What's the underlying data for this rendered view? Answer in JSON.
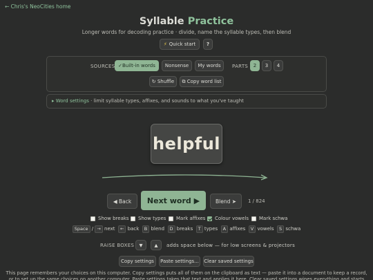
{
  "home_link": "← Chris's NeoCities home",
  "title": {
    "main": "Syllable",
    "accent": "Practice"
  },
  "subtitle": "Longer words for decoding practice · divide, name the syllable types, then blend",
  "quick_start": {
    "icon": "⚡",
    "label": "Quick start",
    "help": "?"
  },
  "sources": {
    "label": "SOURCES",
    "builtin": "✓Built-in words",
    "nonsense": "Nonsense",
    "my_words": "My words"
  },
  "parts": {
    "label": "PARTS",
    "options": [
      "2",
      "3",
      "4"
    ],
    "selected": "2"
  },
  "shuffle": "↻ Shuffle",
  "copy_list": "⧉ Copy word list",
  "word_settings": {
    "heading": "▸ Word settings",
    "text": " · limit syllable types, affixes, and sounds to what you've taught"
  },
  "current_word": "helpful",
  "nav": {
    "back": "◀ Back",
    "next": "Next word ▶",
    "blend": "Blend ➤",
    "counter": "1 / 824"
  },
  "toggles": [
    {
      "label": "Show breaks",
      "checked": false
    },
    {
      "label": "Show types",
      "checked": false
    },
    {
      "label": "Mark affixes",
      "checked": false
    },
    {
      "label": "Colour vowels",
      "checked": true
    },
    {
      "label": "Mark schwa",
      "checked": false
    }
  ],
  "shortcuts": {
    "space": "Space",
    "slash": "/",
    "arrow_right": "→",
    "next": "next",
    "arrow_left": "←",
    "back": "back",
    "b": "B",
    "blend": "blend",
    "d": "D",
    "breaks": "breaks",
    "t": "T",
    "types": "types",
    "a": "A",
    "affixes": "affixes",
    "v": "V",
    "vowels": "vowels",
    "s": "S",
    "schwa": "schwa"
  },
  "raise": {
    "label": "RAISE BOXES",
    "down": "▼",
    "up": "▲",
    "hint": "adds space below — for low screens & projectors"
  },
  "settings_buttons": {
    "copy": "Copy settings",
    "paste": "Paste settings...",
    "clear": "Clear saved settings"
  },
  "footer": "This page remembers your choices on this computer. Copy settings puts all of them on the clipboard as text — paste it into a document to keep a record, or to set up the same choices on another computer. Paste settings takes that text and applies it here. Clear saved settings wipes everything and starts fresh.",
  "colors": {
    "accent": "#8fc29c",
    "active_button": "#8fb594",
    "background": "#2b2c2b"
  }
}
